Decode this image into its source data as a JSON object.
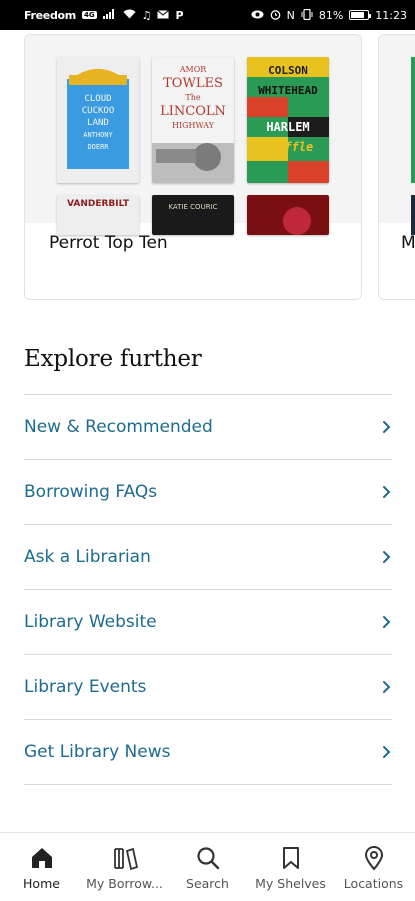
{
  "status_bar": {
    "carrier": "Freedom",
    "carrier_badge": "4G",
    "battery": "81%",
    "time": "11:23",
    "battery_level": 0.81,
    "icons": [
      "signal-icon",
      "wifi-icon",
      "music-icon",
      "mail-icon",
      "p-icon",
      "eye-icon",
      "alarm-icon",
      "nfc-icon",
      "vibrate-icon",
      "battery-icon"
    ]
  },
  "carousel": {
    "cards": [
      {
        "title": "Perrot Top Ten",
        "covers": [
          {
            "name": "cloud-cuckoo-land-cover",
            "lines": [
              "CLOUD",
              "CUCKOO",
              "LAND",
              "ANTHONY",
              "DOERR"
            ],
            "bg": "#f0f0f0",
            "accent": "#2f8fd8"
          },
          {
            "name": "lincoln-highway-cover",
            "lines": [
              "AMOR",
              "TOWLES",
              "The",
              "LINCOLN",
              "HIGHWAY"
            ],
            "bg": "#f2f2f2",
            "accent": "#c0392b"
          },
          {
            "name": "harlem-shuffle-cover",
            "lines": [
              "COLSON",
              "WHITEHEAD",
              "HARLEM",
              "Shuffle"
            ],
            "bg": "#1f8a4a",
            "accent": "#e74c3c"
          },
          {
            "name": "book-cover-4",
            "lines": [
              "VANDERBILT"
            ],
            "bg": "#f0f0f0",
            "accent": "#8b1d1d"
          },
          {
            "name": "book-cover-5",
            "lines": [
              "KATIE COURIC"
            ],
            "bg": "#1a1a1a",
            "accent": "#c9a16a"
          },
          {
            "name": "book-cover-6",
            "lines": [
              ""
            ],
            "bg": "#7a0f12",
            "accent": "#d23"
          }
        ]
      },
      {
        "title": "M"
      }
    ]
  },
  "explore": {
    "title": "Explore further",
    "links": [
      {
        "label": "New & Recommended"
      },
      {
        "label": "Borrowing FAQs"
      },
      {
        "label": "Ask a Librarian"
      },
      {
        "label": "Library Website"
      },
      {
        "label": "Library Events"
      },
      {
        "label": "Get Library News"
      }
    ]
  },
  "bottom_nav": {
    "items": [
      {
        "label": "Home",
        "icon": "home-icon",
        "active": true
      },
      {
        "label": "My Borrow...",
        "icon": "books-icon"
      },
      {
        "label": "Search",
        "icon": "search-icon"
      },
      {
        "label": "My Shelves",
        "icon": "bookmark-icon"
      },
      {
        "label": "Locations",
        "icon": "location-pin-icon"
      }
    ]
  },
  "colors": {
    "link": "#1d6b8f",
    "divider": "#d9d9d9"
  }
}
